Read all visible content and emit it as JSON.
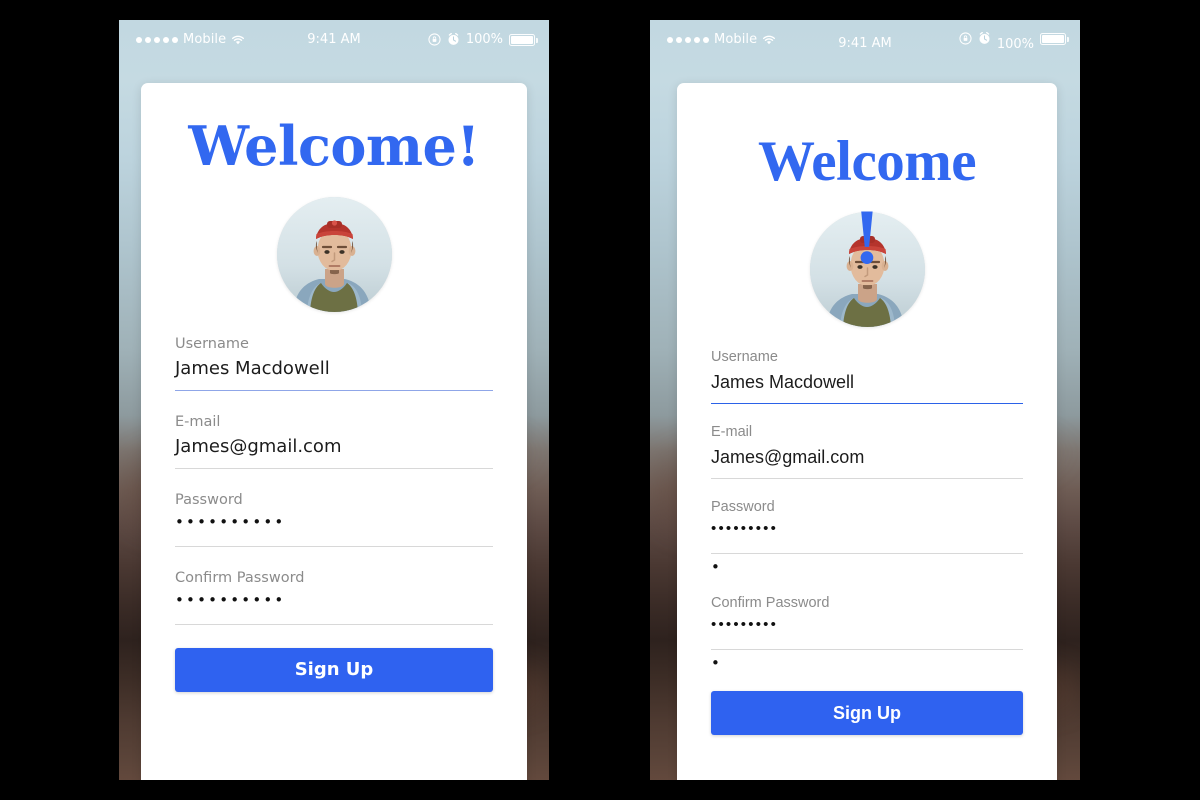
{
  "screens": [
    {
      "id": "left",
      "statusbar": {
        "signal_dots": 5,
        "carrier": "Mobile",
        "wifi_icon": "wifi-icon",
        "time": "9:41 AM",
        "rotation_lock_icon": "rotation-lock-icon",
        "alarm_icon": "alarm-clock-icon",
        "battery_percent": "100%",
        "battery_icon": "battery-full-icon"
      },
      "title": "Welcome!",
      "avatar": {
        "name": "avatar",
        "alt": "Man wearing a backwards red cap and denim jacket"
      },
      "fields": [
        {
          "label": "Username",
          "value": "James Macdowell",
          "type": "text",
          "active": true
        },
        {
          "label": "E-mail",
          "value": "James@gmail.com",
          "type": "text",
          "active": false
        },
        {
          "label": "Password",
          "value": "••••••••••",
          "type": "password",
          "active": false
        },
        {
          "label": "Confirm Password",
          "value": "••••••••••",
          "type": "password",
          "active": false
        }
      ],
      "submit_label": "Sign Up"
    },
    {
      "id": "right",
      "statusbar": {
        "signal_dots": 5,
        "carrier": "Mobile",
        "wifi_icon": "wifi-icon",
        "time": "9:41 AM",
        "rotation_lock_icon": "rotation-lock-icon",
        "alarm_icon": "alarm-clock-icon",
        "battery_percent": "100%",
        "battery_icon": "battery-full-icon"
      },
      "title": "Welcome",
      "stray_exclamation": "!",
      "avatar": {
        "name": "avatar",
        "alt": "Man wearing a backwards red cap and denim jacket"
      },
      "fields": [
        {
          "label": "Username",
          "value": "James Macdowell",
          "type": "text",
          "active": true,
          "overflow": ""
        },
        {
          "label": "E-mail",
          "value": "James@gmail.com",
          "type": "text",
          "active": false,
          "overflow": ""
        },
        {
          "label": "Password",
          "value": "•••••••••",
          "type": "password",
          "active": false,
          "overflow": "•"
        },
        {
          "label": "Confirm Password",
          "value": "•••••••••",
          "type": "password",
          "active": false,
          "overflow": "•"
        }
      ],
      "submit_label": "Sign Up"
    }
  ],
  "colors": {
    "accent_blue": "#2f62f0",
    "title_blue": "#3268f0",
    "active_underline_left": "#8fa6e8",
    "active_underline_right": "#2b62e8",
    "inactive_underline": "#d8d8d8",
    "label_gray": "#8b8b8b",
    "card_white": "#ffffff",
    "page_background": "#000000"
  }
}
